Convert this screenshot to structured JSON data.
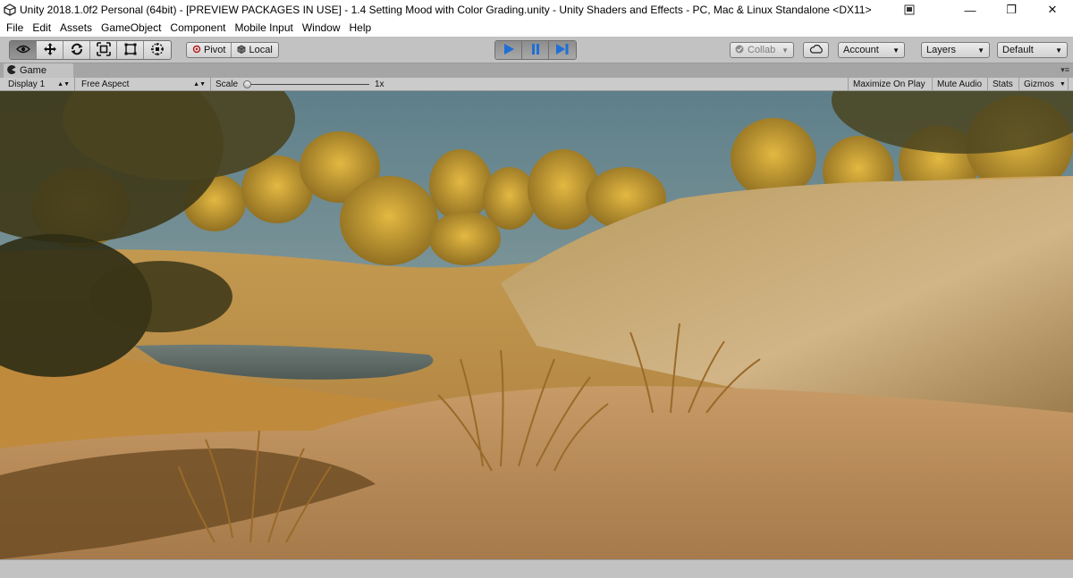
{
  "window": {
    "title": "Unity 2018.1.0f2 Personal (64bit) - [PREVIEW PACKAGES IN USE] - 1.4 Setting Mood with Color Grading.unity - Unity Shaders and Effects - PC, Mac & Linux Standalone <DX11>",
    "minimize_glyph": "—",
    "maximize_glyph": "❐",
    "close_glyph": "✕"
  },
  "menu": [
    "File",
    "Edit",
    "Assets",
    "GameObject",
    "Component",
    "Mobile Input",
    "Window",
    "Help"
  ],
  "toolbar": {
    "tools": [
      {
        "icon": "eye-icon",
        "active": true
      },
      {
        "icon": "move-icon",
        "active": false
      },
      {
        "icon": "rotate-icon",
        "active": false
      },
      {
        "icon": "scale-icon",
        "active": false
      },
      {
        "icon": "rect-icon",
        "active": false
      },
      {
        "icon": "transform-icon",
        "active": false
      }
    ],
    "pivot_label": "Pivot",
    "local_label": "Local",
    "collab_label": "Collab",
    "account_label": "Account",
    "layers_label": "Layers",
    "layout_label": "Default",
    "play_color": "#1f6fd6"
  },
  "game_tab": {
    "label": "Game",
    "display": "Display 1",
    "aspect": "Free Aspect",
    "scale_label": "Scale",
    "scale_value": "1x",
    "scale_level": 0,
    "maximize_on_play": "Maximize On Play",
    "mute_audio": "Mute Audio",
    "stats": "Stats",
    "gizmos": "Gizmos"
  }
}
